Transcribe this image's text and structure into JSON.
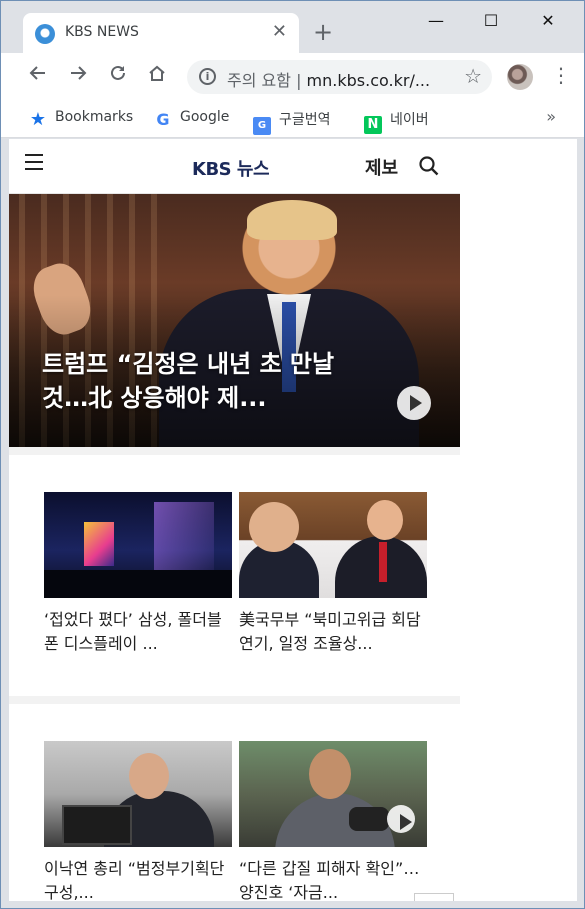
{
  "browser": {
    "tab_title": "KBS NEWS",
    "tab_close_glyph": "✕",
    "new_tab_glyph": "+",
    "window_minimize": "—",
    "window_maximize": "☐",
    "window_close": "✕",
    "security_label": "주의 요함",
    "url": "mn.kbs.co.kr/...",
    "url_separator": "|",
    "bookmarks": [
      {
        "label": "Bookmarks",
        "icon": "star-icon"
      },
      {
        "label": "Google",
        "icon": "google-icon"
      },
      {
        "label": "구글번역",
        "icon": "google-translate-icon"
      },
      {
        "label": "네이버",
        "icon": "naver-icon"
      }
    ],
    "bookmarks_more": "»"
  },
  "site": {
    "logo_brand": "KBS",
    "logo_suffix": "뉴스",
    "report_button": "제보"
  },
  "hero": {
    "title": "트럼프 “김정은 내년 초 만날 것…北 상응해야 제..."
  },
  "cards": [
    {
      "title": "‘접었다 폈다’ 삼성, 폴더블폰 디스플레이 ..."
    },
    {
      "title": "美국무부 “북미고위급 회담 연기, 일정 조율상..."
    },
    {
      "title": "이낙연 총리 “범정부기획단 구성,..."
    },
    {
      "title": "“다른 갑질 피해자 확인”…양진호 ‘자금..."
    }
  ],
  "colors": {
    "chrome_frame": "#dee1e6",
    "kbs_navy": "#1c2a5a",
    "naver_green": "#03c75a"
  }
}
